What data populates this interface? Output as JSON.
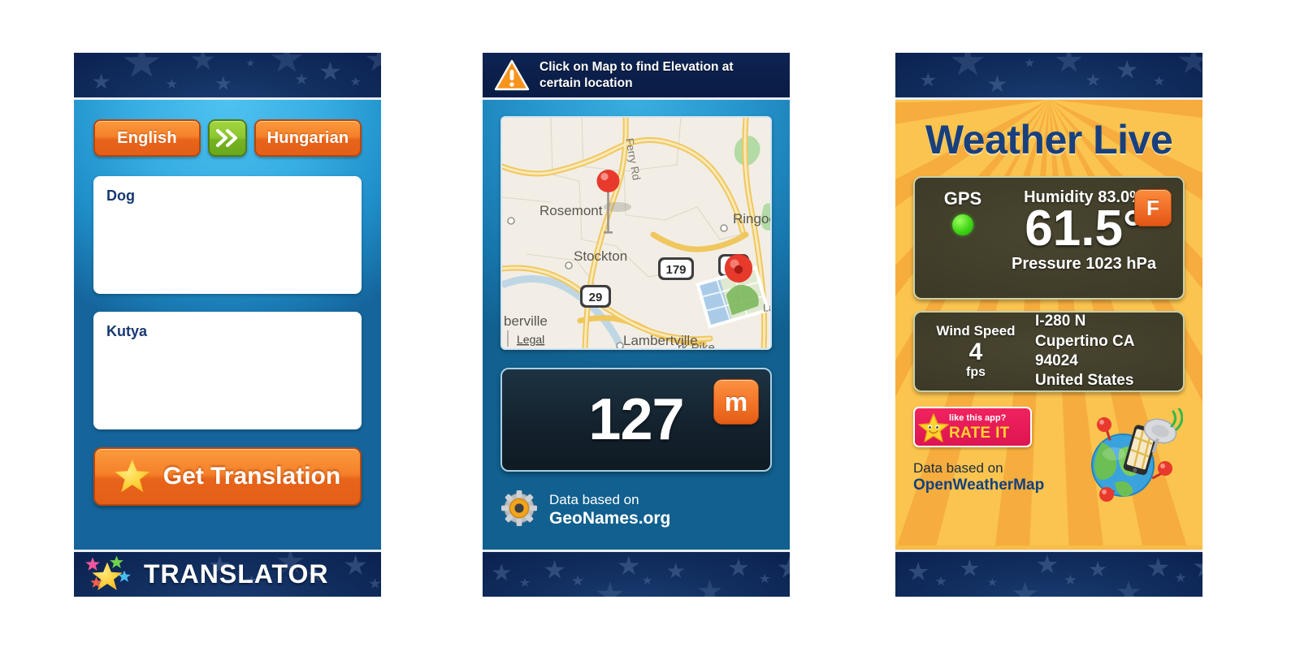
{
  "app_screens": [
    {
      "id": "translator",
      "name": "Translator",
      "header": {
        "type": "star-band"
      },
      "source_language_button": "English",
      "swap_icon": "double-chevron-right-icon",
      "target_language_button": "Hungarian",
      "source_text": "Dog",
      "target_text": "Kutya",
      "translate_button": "Get Translation",
      "translate_button_icon": "star-icon",
      "footer_title": "TRANSLATOR",
      "footer_icon": "star-cluster-icon"
    },
    {
      "id": "elevation",
      "name": "Elevation",
      "header_icon": "warning-triangle-icon",
      "header_text_line1": "Click on Map to find Elevation at",
      "header_text_line2": "certain location",
      "map": {
        "legal_link": "Legal",
        "places": [
          "Rosemont",
          "Stockton",
          "Ringoes",
          "Lambertville",
          "berville"
        ],
        "road_label": "Ferry Rd",
        "shields": [
          "29",
          "179",
          "31"
        ],
        "extra_labels": [
          "rk Pike",
          "Lambertville"
        ],
        "pins": [
          "map-pin-primary",
          "map-pin-secondary"
        ]
      },
      "elevation_value": "127",
      "elevation_unit_button": "m",
      "credit_line1": "Data based on",
      "credit_line2": "GeoNames.org",
      "credit_icon": "gear-icon"
    },
    {
      "id": "weather",
      "name": "Weather Live",
      "title": "Weather Live",
      "gps_label": "GPS",
      "gps_status_icon": "green-status-dot",
      "humidity": "Humidity 83.0%",
      "temperature": "61.5°",
      "pressure": "Pressure 1023 hPa",
      "unit_button": "F",
      "wind_label": "Wind Speed",
      "wind_value": "4",
      "wind_unit": "fps",
      "address_line1": "I-280 N",
      "address_line2": "Cupertino CA 94024",
      "address_line3": "United States",
      "rate_badge_line1": "like this app?",
      "rate_badge_line2": "RATE IT",
      "rate_badge_icon": "smiling-star-icon",
      "credit_line1": "Data based on",
      "credit_line2": "OpenWeatherMap",
      "globe_icon": "globe-satellite-phone-icon"
    }
  ],
  "colors": {
    "star_band": "#0b2150",
    "translator_blue": "#2694cc",
    "orange_button": "#f0781f",
    "green_swap": "#8cc631",
    "weather_yellow": "#fbc44f",
    "weather_title_navy": "#18407e",
    "dark_card": "#3e3b28",
    "rate_pink": "#dd1550",
    "gps_green": "#41d516"
  }
}
